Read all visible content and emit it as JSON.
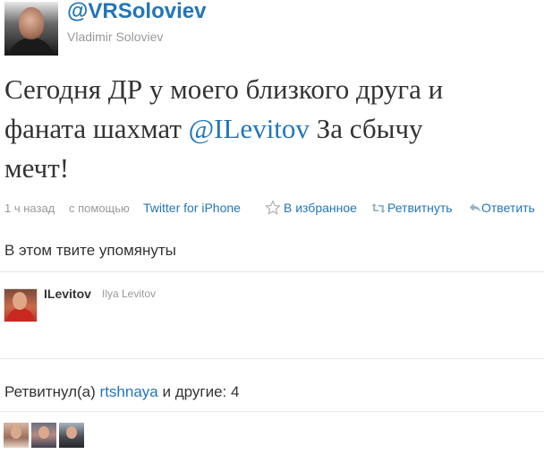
{
  "header": {
    "username": "@VRSoloviev",
    "fullname": "Vladimir Soloviev"
  },
  "tweet": {
    "line1": "Сегодня ДР у моего близкого друга и",
    "line2_before": "фаната шахмат ",
    "line2_mention": "@ILevitov",
    "line2_after": " За сбычу",
    "line3": "мечт!"
  },
  "meta": {
    "time": "1 ч назад",
    "via_label": "с помощью",
    "via_app": "Twitter for iPhone",
    "favorite_label": "В избранное",
    "retweet_label": "Ретвитнуть",
    "reply_label": "Ответить"
  },
  "mentioned": {
    "heading": "В этом твите упомянуты",
    "users": [
      {
        "screen_name": "ILevitov",
        "real_name": "Ilya Levitov"
      }
    ]
  },
  "retweeted": {
    "prefix": "Ретвитнул(а)",
    "user": "rtshnaya",
    "suffix": "и другие: 4"
  },
  "icons": {
    "favorite": "star-icon",
    "retweet": "retweet-icon",
    "reply": "reply-icon"
  },
  "colors": {
    "link": "#2276bb",
    "muted": "#999999",
    "text": "#333333"
  }
}
